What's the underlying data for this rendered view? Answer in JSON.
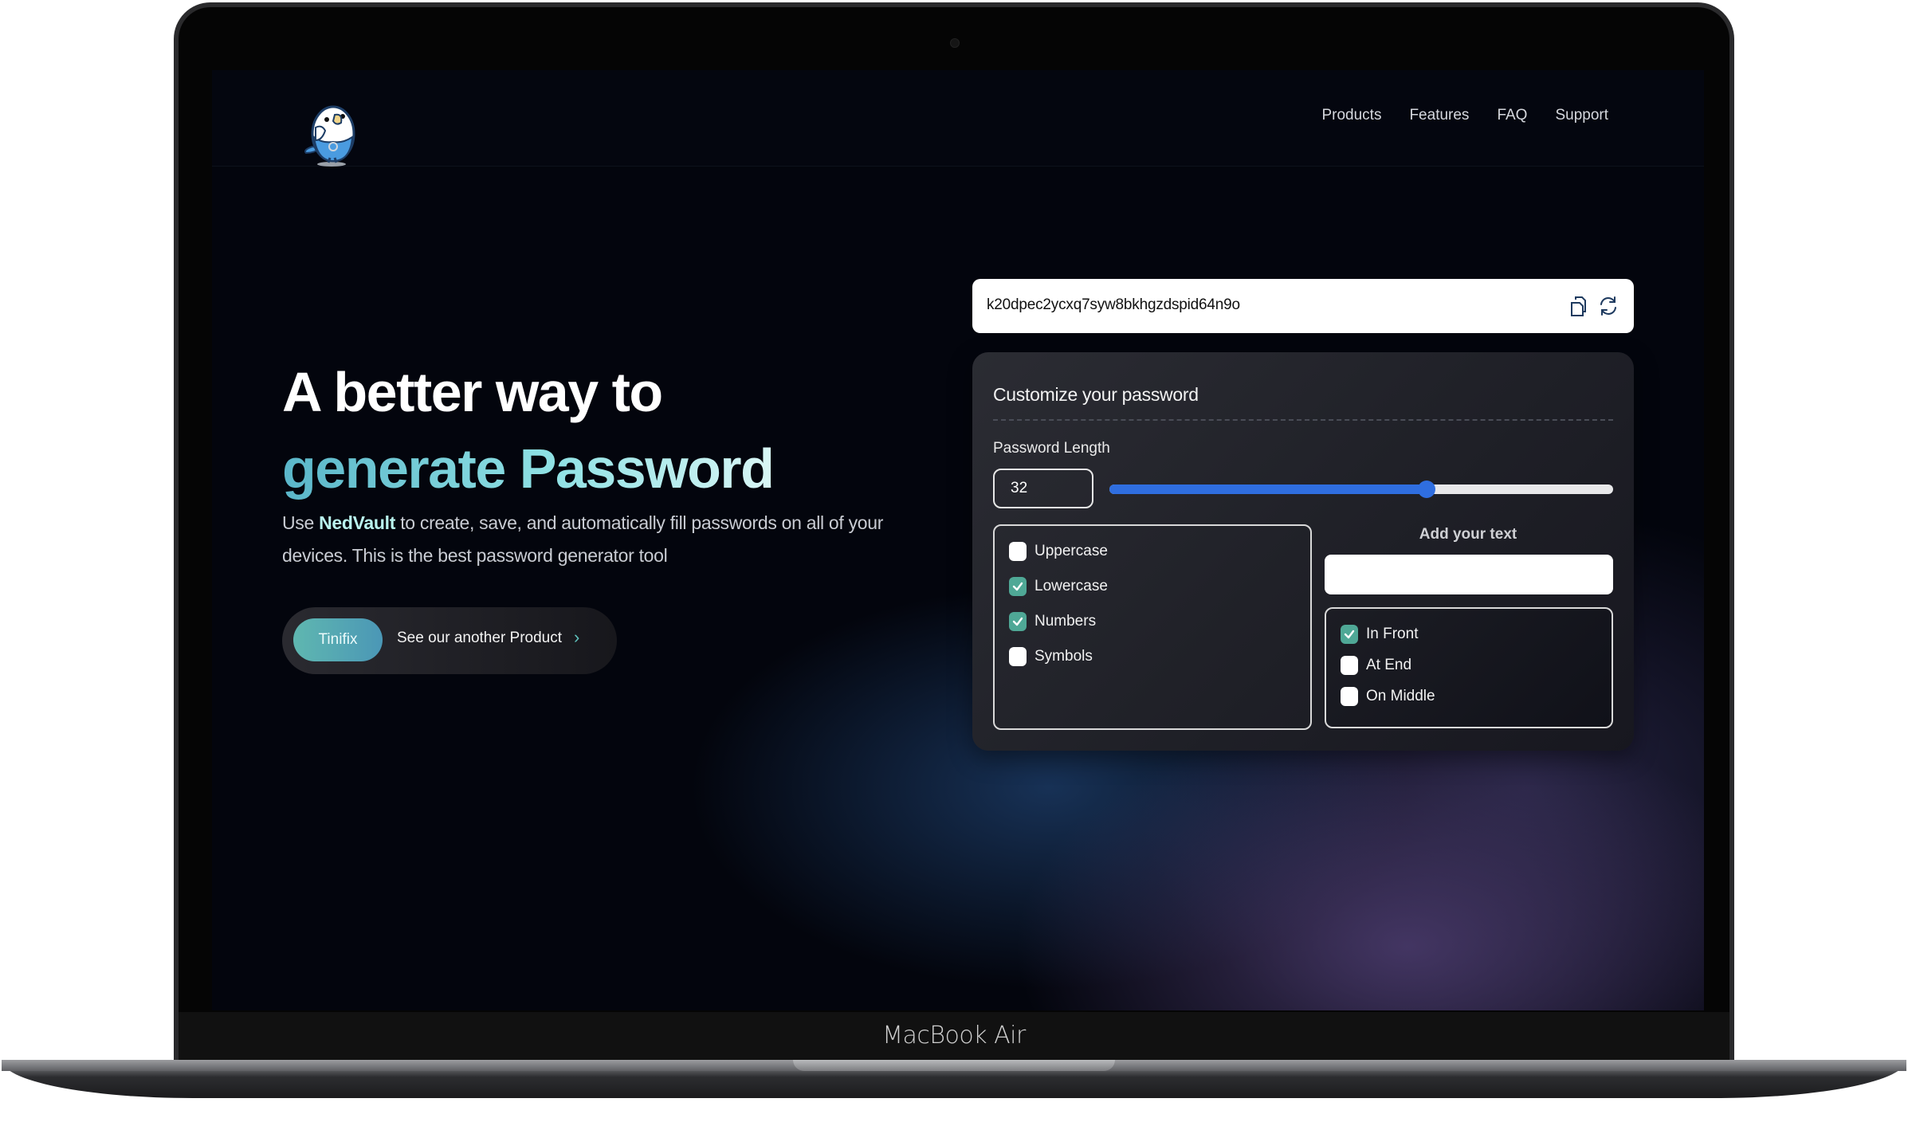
{
  "device": {
    "label": "MacBook Air"
  },
  "header": {
    "logo_alt": "NedVault parakeet mascot",
    "nav": [
      "Products",
      "Features",
      "FAQ",
      "Support"
    ]
  },
  "hero": {
    "title_line1": "A better way to",
    "title_line2": "generate Password",
    "desc_prefix": "Use ",
    "desc_brand": "NedVault",
    "desc_suffix": " to create, save, and automatically fill passwords on all of your devices. This is the best password generator tool",
    "cta_button": "Tinifix",
    "cta_link": "See our another Product",
    "cta_chevron_icon": "chevron-right-icon"
  },
  "generator": {
    "password": "k20dpec2ycxq7syw8bkhgzdspid64n9o",
    "copy_icon": "clipboard-copy-icon",
    "refresh_icon": "refresh-icon",
    "title": "Customize your password",
    "length_label": "Password Length",
    "length_value": "32",
    "slider_fraction": 0.63,
    "char_options": [
      {
        "label": "Uppercase",
        "checked": false
      },
      {
        "label": "Lowercase",
        "checked": true
      },
      {
        "label": "Numbers",
        "checked": true
      },
      {
        "label": "Symbols",
        "checked": false
      }
    ],
    "add_text_label": "Add your text",
    "add_text_value": "",
    "position_options": [
      {
        "label": "In Front",
        "checked": true
      },
      {
        "label": "At End",
        "checked": false
      },
      {
        "label": "On Middle",
        "checked": false
      }
    ]
  },
  "colors": {
    "accent_teal": "#4fa896",
    "slider_blue": "#2f6ee0",
    "background": "#03050d"
  }
}
